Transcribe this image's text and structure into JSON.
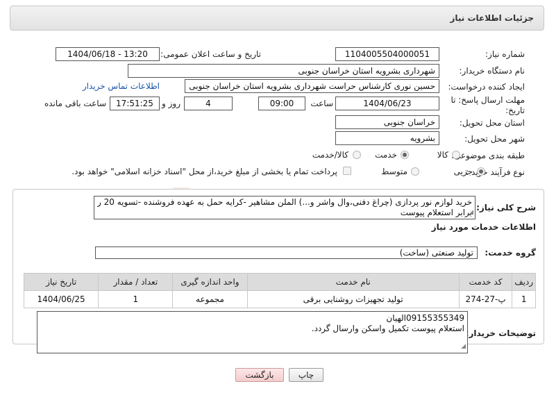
{
  "header": {
    "title": "جزئیات اطلاعات نیاز"
  },
  "form": {
    "need_number_label": "شماره نیاز:",
    "need_number": "1104005504000051",
    "announce_label": "تاریخ و ساعت اعلان عمومی:",
    "announce_value": "1404/06/18 - 13:20",
    "buyer_org_label": "نام دستگاه خریدار:",
    "buyer_org": "شهرداری بشرویه استان خراسان جنوبی",
    "creator_label": "ایجاد کننده درخواست:",
    "creator": "حسین نوری کارشناس حراست شهرداری بشرویه استان خراسان جنوبی",
    "contact_link": "اطلاعات تماس خریدار",
    "deadline_label_1": "مهلت ارسال پاسخ: تا",
    "deadline_label_2": "تاریخ:",
    "deadline_date": "1404/06/23",
    "time_label": "ساعت",
    "deadline_time": "09:00",
    "days_value": "4",
    "days_label": "روز و",
    "remaining_time": "17:51:25",
    "remaining_label": "ساعت باقی مانده",
    "province_label": "استان محل تحویل:",
    "province": "خراسان جنوبی",
    "city_label": "شهر محل تحویل:",
    "city": "بشرویه",
    "category_label": "طبقه بندی موضوعی:",
    "category_options": [
      "کالا",
      "خدمت",
      "کالا/خدمت"
    ],
    "category_selected": "خدمت",
    "process_label": "نوع فرآیند خرید :",
    "process_options": [
      "جزیی",
      "متوسط"
    ],
    "process_selected": "جزیی",
    "payment_note": "پرداخت تمام یا بخشی از مبلغ خرید،از محل \"اسناد خزانه اسلامی\" خواهد بود."
  },
  "details": {
    "summary_label": "شرح کلی نیاز:",
    "summary_line1": "خرید لوازم نور پردازی (چراغ دفنی،وال واشر و...) الملن مشاهیر -کرایه حمل به عهده فروشنده -تسویه 20 روزه",
    "summary_line2": "برابر استعلام پیوست",
    "services_title": "اطلاعات خدمات مورد نیاز",
    "group_label": "گروه خدمت:",
    "group_value": "تولید صنعتی (ساخت)",
    "table": {
      "headers": [
        "ردیف",
        "کد خدمت",
        "نام خدمت",
        "واحد اندازه گیری",
        "تعداد / مقدار",
        "تاریخ نیاز"
      ],
      "rows": [
        [
          "1",
          "پ-27-274",
          "تولید تجهیزات روشنایی برقی",
          "مجموعه",
          "1",
          "1404/06/25"
        ]
      ]
    },
    "buyer_notes_label": "توضیحات خریدار:",
    "buyer_notes_line1": "09155355349الهیان",
    "buyer_notes_line2": "استعلام پیوست تکمیل  واسکن  وارسال گردد."
  },
  "buttons": {
    "print": "چاپ",
    "back": "بازگشت"
  },
  "watermark": {
    "text": "AriaTender.neT"
  }
}
